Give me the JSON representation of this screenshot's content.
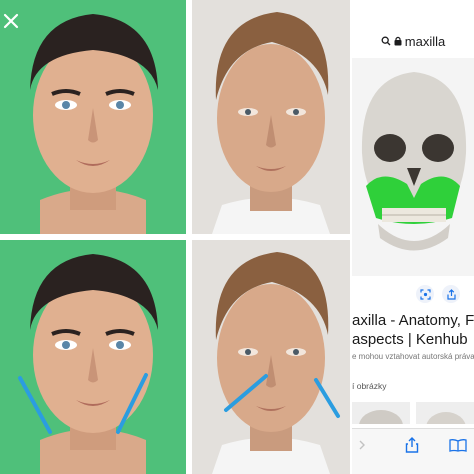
{
  "browser": {
    "address_text": "maxilla",
    "result_title_lines": [
      "axilla - Anatomy, Functio",
      "aspects | Kenhub"
    ],
    "copyright_note": "e mohou vztahovat autorská práva. Da",
    "related_label": "í obrázky"
  },
  "icons": {
    "close": "close-icon",
    "search": "search-icon",
    "lock": "lock-icon",
    "lens": "lens-icon",
    "share": "share-icon",
    "bookmark": "bookmark-icon"
  },
  "colors": {
    "green_background": "#4fc07a",
    "jaw_line_blue": "#2b9de0",
    "maxilla_highlight": "#2fd03a",
    "link_blue": "#1a73e8"
  }
}
